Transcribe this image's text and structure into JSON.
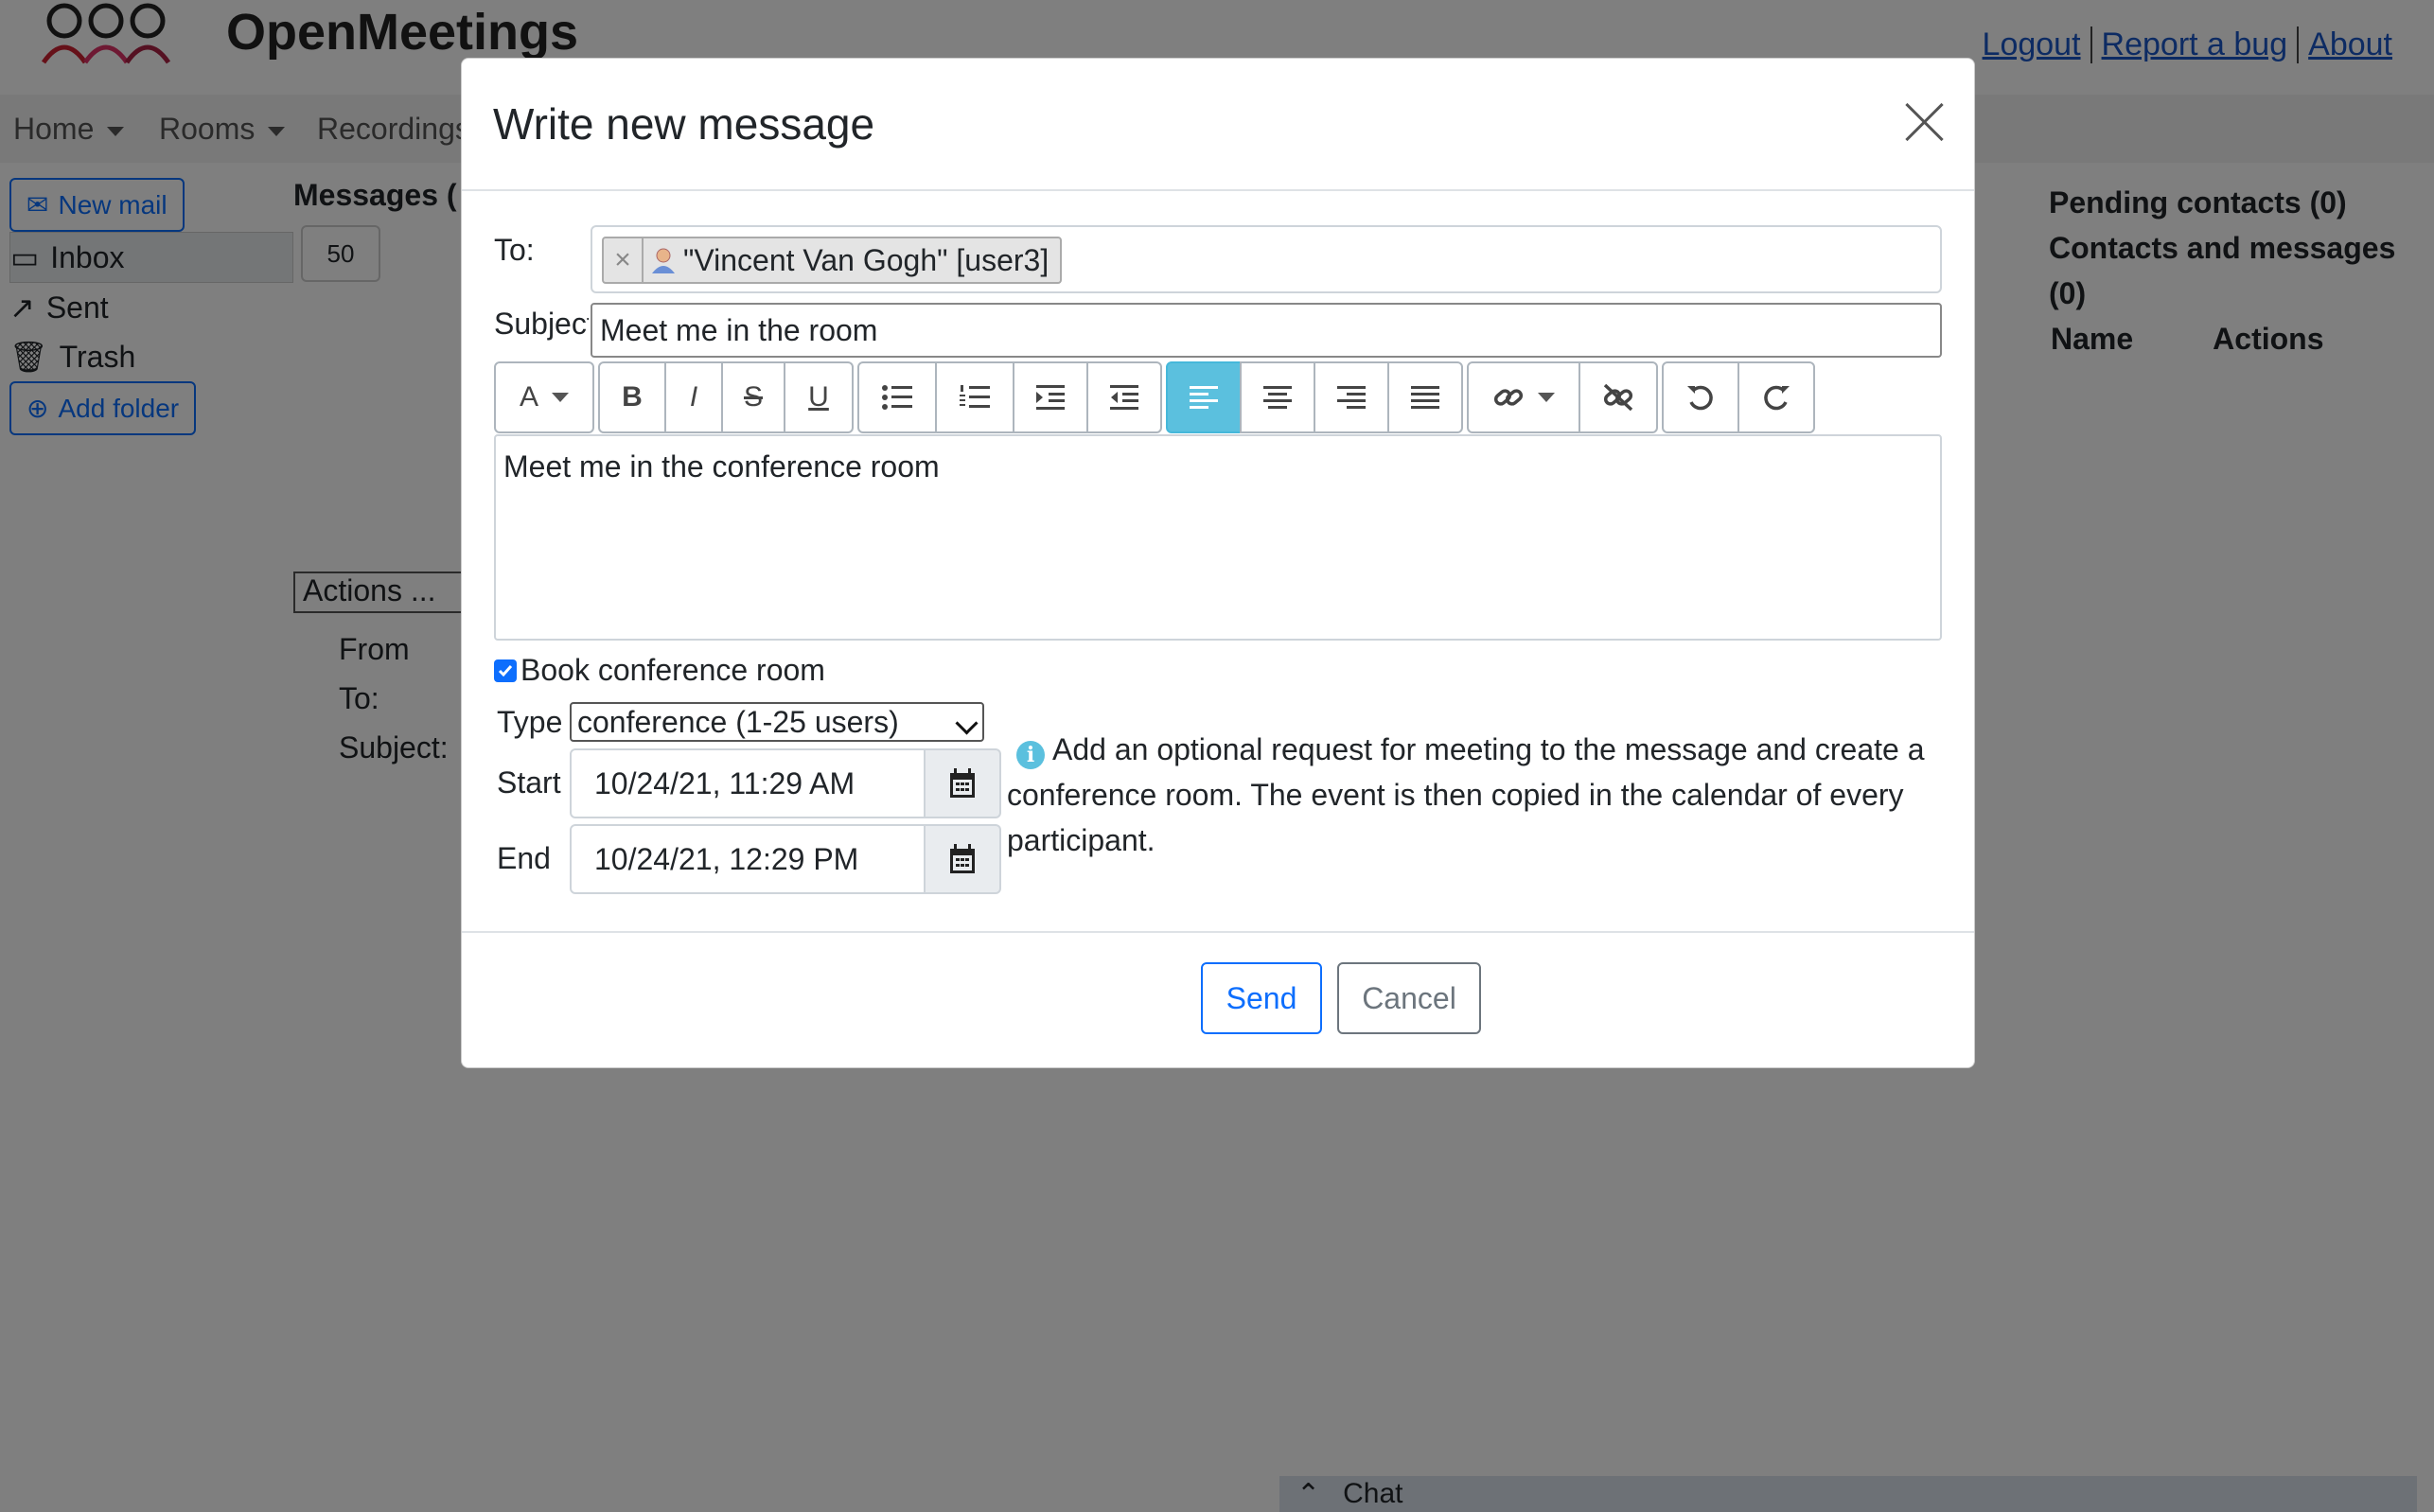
{
  "app": {
    "title": "OpenMeetings"
  },
  "top_links": [
    "Logout",
    "Report a bug",
    "About"
  ],
  "nav": {
    "home": "Home",
    "rooms": "Rooms",
    "recordings": "Recordings"
  },
  "leftnav": {
    "new_mail": "New mail",
    "inbox": "Inbox",
    "sent": "Sent",
    "trash": "Trash",
    "add_folder": "Add folder"
  },
  "messages": {
    "title": "Messages (",
    "page_size": "50",
    "actions": "Actions ...",
    "from_label": "From",
    "to_label": "To:",
    "subject_label": "Subject:"
  },
  "rightpanel": {
    "pending": "Pending contacts (0)",
    "contacts": "Contacts and messages (0)",
    "name_col": "Name",
    "actions_col": "Actions"
  },
  "chat": {
    "label": "Chat"
  },
  "modal": {
    "title": "Write new message",
    "to_label": "To:",
    "recipient": "\"Vincent Van Gogh\" [user3]",
    "subject_label": "Subject",
    "subject_value": "Meet me in the room",
    "body": "Meet me in the conference room",
    "book_label": "Book conference room",
    "book_checked": true,
    "type_label": "Type",
    "type_value": "conference (1-25 users)",
    "start_label": "Start",
    "start_value": "10/24/21, 11:29 AM",
    "end_label": "End",
    "end_value": "10/24/21, 12:29 PM",
    "info": "Add an optional request for meeting to the message and create a conference room. The event is then copied in the calendar of every participant.",
    "send": "Send",
    "cancel": "Cancel"
  },
  "toolbar": {
    "font_letter": "A",
    "bold": "B",
    "italic": "I",
    "strike": "S",
    "underline": "U",
    "active_tool": "align-left"
  },
  "colors": {
    "accent": "#0d6efd",
    "active_tool": "#5bc0de",
    "overlay": "rgba(0,0,0,0.5)"
  }
}
